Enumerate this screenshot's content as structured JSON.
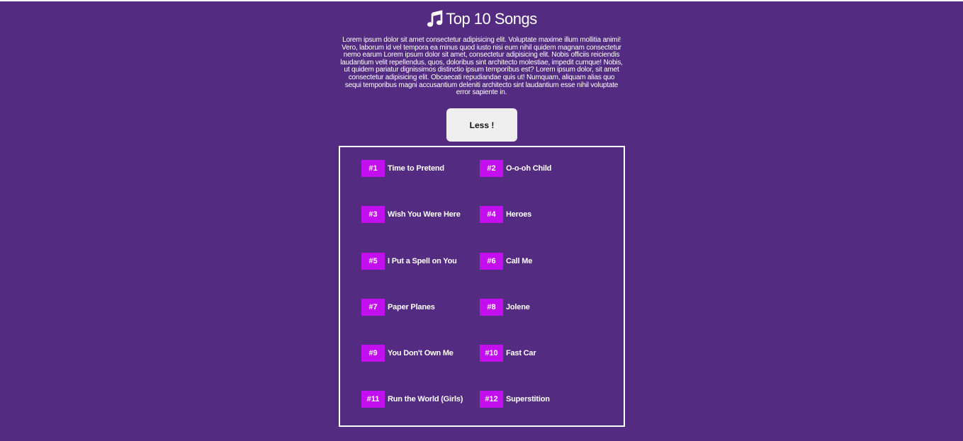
{
  "header": {
    "icon": "music-note-icon",
    "title": "Top 10 Songs"
  },
  "description": "Lorem ipsum dolor sit amet consectetur adipisicing elit. Voluptate maxime illum mollitia animi! Vero, laborum id vel tempora ea minus quod iusto nisi eum nihil quidem magnam consectetur nemo earum Lorem ipsum dolor sit amet, consectetur adipisicing elit. Nobis officiis reiciendis laudantium velit repellendus, quos, doloribus sint architecto molestiae, impedit cumque! Nobis, ut quidem pariatur dignissimos distinctio ipsum temporibus est? Lorem ipsum dolor, sit amet consectetur adipisicing elit. Obcaecati repudiandae quis ut! Numquam, aliquam alias quo sequi temporibus magni accusantium deleniti architecto sint laudantium esse nihil voluptate error sapiente in.",
  "toggle_button": {
    "label": "Less !"
  },
  "colors": {
    "background": "#532c81",
    "rank_badge": "#c30ff0",
    "button": "#efeff0"
  },
  "songs": [
    {
      "rank": "#1",
      "name": "Time to Pretend"
    },
    {
      "rank": "#2",
      "name": "O-o-oh Child"
    },
    {
      "rank": "#3",
      "name": "Wish You Were Here"
    },
    {
      "rank": "#4",
      "name": "Heroes"
    },
    {
      "rank": "#5",
      "name": "I Put a Spell on You"
    },
    {
      "rank": "#6",
      "name": "Call Me"
    },
    {
      "rank": "#7",
      "name": "Paper Planes"
    },
    {
      "rank": "#8",
      "name": "Jolene"
    },
    {
      "rank": "#9",
      "name": "You Don't Own Me"
    },
    {
      "rank": "#10",
      "name": "Fast Car"
    },
    {
      "rank": "#11",
      "name": "Run the World (Girls)"
    },
    {
      "rank": "#12",
      "name": "Superstition"
    }
  ]
}
